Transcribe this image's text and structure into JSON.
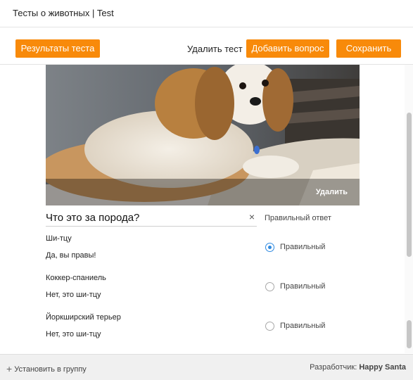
{
  "window": {
    "title": "Тесты о животных | Test"
  },
  "toolbar": {
    "results_label": "Результаты теста",
    "delete_test_label": "Удалить тест",
    "add_question_label": "Добавить вопрос",
    "save_label": "Сохранить"
  },
  "question": {
    "image_delete_label": "Удалить",
    "text": "Что это за порода?",
    "clear_icon": "×",
    "correct_header": "Правильный ответ",
    "answers": [
      {
        "name": "Ши-тцу",
        "comment": "Да, вы правы!",
        "radio_label": "Правильный",
        "checked": true
      },
      {
        "name": "Коккер-спаниель",
        "comment": "Нет, это ши-тцу",
        "radio_label": "Правильный",
        "checked": false
      },
      {
        "name": "Йоркширский терьер",
        "comment": "Нет, это ши-тцу",
        "radio_label": "Правильный",
        "checked": false
      }
    ]
  },
  "footer": {
    "install_icon": "+",
    "install_label": "Установить в группу",
    "developer_label": "Разработчик:",
    "developer_name": "Happy Santa"
  },
  "colors": {
    "accent": "#f88a0a",
    "radio": "#2f8ae0"
  }
}
